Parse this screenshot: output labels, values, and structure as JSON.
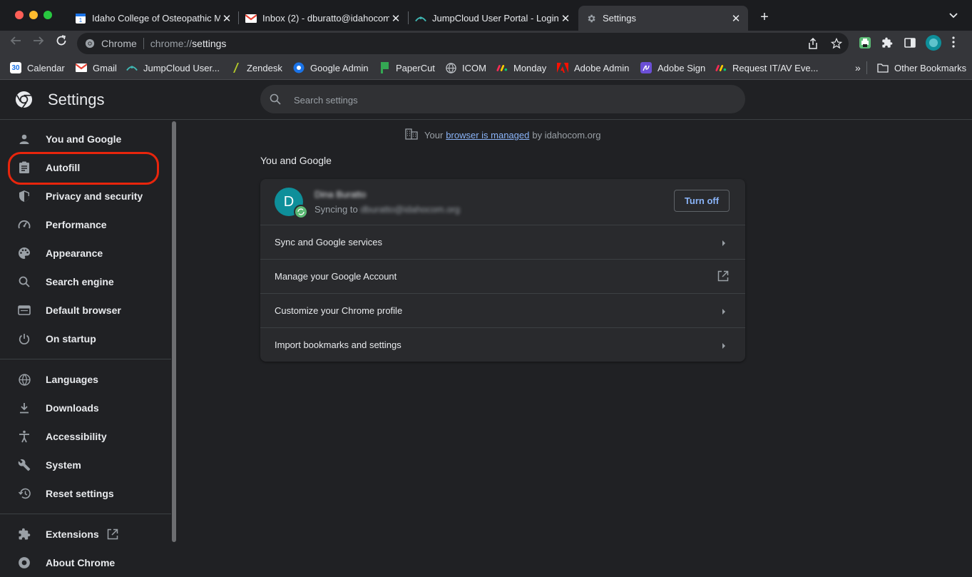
{
  "tabs": [
    {
      "title": "Idaho College of Osteopathic M",
      "icon": "google-calendar-icon"
    },
    {
      "title": "Inbox (2) - dburatto@idahocom",
      "icon": "gmail-icon"
    },
    {
      "title": "JumpCloud User Portal - Login",
      "icon": "jumpcloud-icon"
    },
    {
      "title": "Settings",
      "icon": "gear-icon",
      "active": true
    }
  ],
  "omnibox": {
    "chip": "Chrome",
    "scheme": "chrome://",
    "path": "settings"
  },
  "bookmarks": [
    {
      "label": "Calendar",
      "icon": "calendar-icon"
    },
    {
      "label": "Gmail",
      "icon": "gmail-icon"
    },
    {
      "label": "JumpCloud User...",
      "icon": "jumpcloud-icon"
    },
    {
      "label": "Zendesk",
      "icon": "zendesk-icon"
    },
    {
      "label": "Google Admin",
      "icon": "google-admin-icon"
    },
    {
      "label": "PaperCut",
      "icon": "papercut-icon"
    },
    {
      "label": "ICOM",
      "icon": "globe-icon"
    },
    {
      "label": "Monday",
      "icon": "monday-icon"
    },
    {
      "label": "Adobe Admin",
      "icon": "adobe-icon"
    },
    {
      "label": "Adobe Sign",
      "icon": "adobe-sign-icon"
    },
    {
      "label": "Request IT/AV Eve...",
      "icon": "monday-icon"
    }
  ],
  "other_bookmarks": "Other Bookmarks",
  "settings": {
    "title": "Settings",
    "search_placeholder": "Search settings"
  },
  "sidebar": {
    "items": [
      {
        "label": "You and Google",
        "icon": "person-icon"
      },
      {
        "label": "Autofill",
        "icon": "clipboard-icon"
      },
      {
        "label": "Privacy and security",
        "icon": "shield-icon"
      },
      {
        "label": "Performance",
        "icon": "speedometer-icon"
      },
      {
        "label": "Appearance",
        "icon": "palette-icon"
      },
      {
        "label": "Search engine",
        "icon": "search-icon"
      },
      {
        "label": "Default browser",
        "icon": "browser-window-icon"
      },
      {
        "label": "On startup",
        "icon": "power-icon"
      },
      {
        "label": "Languages",
        "icon": "globe-icon"
      },
      {
        "label": "Downloads",
        "icon": "download-icon"
      },
      {
        "label": "Accessibility",
        "icon": "accessibility-icon"
      },
      {
        "label": "System",
        "icon": "wrench-icon"
      },
      {
        "label": "Reset settings",
        "icon": "history-icon"
      },
      {
        "label": "Extensions",
        "icon": "puzzle-icon"
      },
      {
        "label": "About Chrome",
        "icon": "chrome-icon"
      }
    ]
  },
  "managed": {
    "prefix": "Your",
    "link": "browser is managed",
    "suffix": "by idahocom.org"
  },
  "you_and_google": {
    "section_title": "You and Google",
    "profile": {
      "initial": "D",
      "name": "Dina Buratto",
      "sync_prefix": "Syncing to",
      "email": "dburatto@idahocom.org"
    },
    "turn_off": "Turn off",
    "rows": [
      {
        "label": "Sync and Google services",
        "icon": "arrow-right-icon"
      },
      {
        "label": "Manage your Google Account",
        "icon": "external-link-icon"
      },
      {
        "label": "Customize your Chrome profile",
        "icon": "arrow-right-icon"
      },
      {
        "label": "Import bookmarks and settings",
        "icon": "arrow-right-icon"
      }
    ]
  },
  "colors": {
    "accent": "#8ab4f8",
    "highlight": "#e8250c",
    "background": "#202124"
  }
}
